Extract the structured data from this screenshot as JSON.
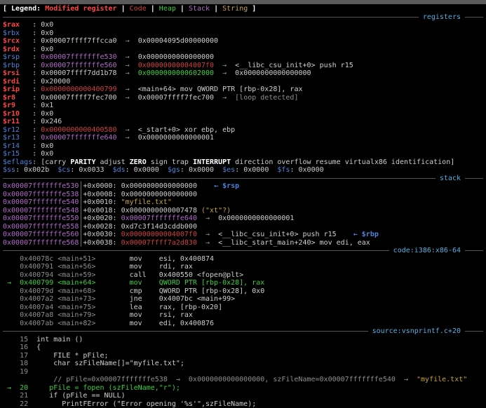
{
  "app": "gdb-gef-debugger-terminal",
  "palette": {
    "bg": "#000000",
    "chrome": "#5a5a5a",
    "fg": "#cfcfcf",
    "white_bold": "#ffffff",
    "reg_modified": "#ff4545",
    "code_red": "#cf4040",
    "blue": "#4f83d8",
    "purple": "#b06cc8",
    "yellow": "#c7a543",
    "green": "#3ecf3e",
    "gray": "#8f8f8f",
    "cyan": "#58aee0",
    "sep_line": "#565656"
  },
  "sections": [
    "registers",
    "stack",
    "code:i386:x86-64",
    "source:vsnprintf.c+20"
  ],
  "lines": [
    {
      "n": "legend-bar",
      "s": [
        [
          "[ Legend: ",
          "wb"
        ],
        [
          "Modified register",
          "rn"
        ],
        [
          " | ",
          "wb"
        ],
        [
          "Code",
          "rd"
        ],
        [
          " | ",
          "wb"
        ],
        [
          "Heap",
          "gn"
        ],
        [
          " | ",
          "wb"
        ],
        [
          "Stack",
          "pu"
        ],
        [
          " | ",
          "wb"
        ],
        [
          "String",
          "yl"
        ],
        [
          " ]",
          "wb"
        ]
      ]
    },
    {
      "sep": "registers",
      "n": "registers-separator"
    },
    {
      "n": "reg-rax",
      "s": [
        [
          "$rax",
          "rn"
        ],
        [
          "   : ",
          "w"
        ],
        [
          "0x0",
          "w"
        ]
      ]
    },
    {
      "n": "reg-rbx",
      "s": [
        [
          "$rbx",
          "bl"
        ],
        [
          "   : ",
          "w"
        ],
        [
          "0x0",
          "w"
        ]
      ]
    },
    {
      "n": "reg-rcx",
      "s": [
        [
          "$rcx",
          "rn"
        ],
        [
          "   : ",
          "w"
        ],
        [
          "0x00007ffff7ffcca0",
          "w"
        ],
        [
          "  →  ",
          "gy"
        ],
        [
          "0x00004095d00000000",
          "w"
        ]
      ]
    },
    {
      "n": "reg-rdx",
      "s": [
        [
          "$rdx",
          "rn"
        ],
        [
          "   : ",
          "w"
        ],
        [
          "0x0",
          "w"
        ]
      ]
    },
    {
      "n": "reg-rsp",
      "s": [
        [
          "$rsp",
          "bl"
        ],
        [
          "   : ",
          "w"
        ],
        [
          "0x00007fffffffe530",
          "pu"
        ],
        [
          "  →  ",
          "gy"
        ],
        [
          "0x0000000000000000",
          "w"
        ]
      ]
    },
    {
      "n": "reg-rbp",
      "s": [
        [
          "$rbp",
          "bl"
        ],
        [
          "   : ",
          "w"
        ],
        [
          "0x00007fffffffe560",
          "pu"
        ],
        [
          "  →  ",
          "gy"
        ],
        [
          "0x00000000004007f0",
          "rd"
        ],
        [
          "  →  ",
          "gy"
        ],
        [
          "<__libc_csu_init+0> push r15",
          "w"
        ]
      ]
    },
    {
      "n": "reg-rsi",
      "s": [
        [
          "$rsi",
          "rn"
        ],
        [
          "   : ",
          "w"
        ],
        [
          "0x00007ffff7dd1b78",
          "w"
        ],
        [
          "  →  ",
          "gy"
        ],
        [
          "0x0000000000602000",
          "gn"
        ],
        [
          "  →  ",
          "gy"
        ],
        [
          "0x0000000000000000",
          "w"
        ]
      ]
    },
    {
      "n": "reg-rdi",
      "s": [
        [
          "$rdi",
          "rn"
        ],
        [
          "   : ",
          "w"
        ],
        [
          "0x20000",
          "w"
        ]
      ]
    },
    {
      "n": "reg-rip",
      "s": [
        [
          "$rip",
          "rn"
        ],
        [
          "   : ",
          "w"
        ],
        [
          "0x0000000000400799",
          "rd"
        ],
        [
          "  →  ",
          "gy"
        ],
        [
          "<main+64> mov QWORD PTR [rbp-0x28], rax",
          "w"
        ]
      ]
    },
    {
      "n": "reg-r8",
      "s": [
        [
          "$r8",
          "rn"
        ],
        [
          "    : ",
          "w"
        ],
        [
          "0x00007ffff7fec700",
          "w"
        ],
        [
          "  →  ",
          "gy"
        ],
        [
          "0x00007ffff7fec700",
          "w"
        ],
        [
          "  →  ",
          "gy"
        ],
        [
          "[loop detected]",
          "gy"
        ]
      ]
    },
    {
      "n": "reg-r9",
      "s": [
        [
          "$r9",
          "rn"
        ],
        [
          "    : ",
          "w"
        ],
        [
          "0x1",
          "w"
        ]
      ]
    },
    {
      "n": "reg-r10",
      "s": [
        [
          "$r10",
          "rn"
        ],
        [
          "   : ",
          "w"
        ],
        [
          "0x0",
          "w"
        ]
      ]
    },
    {
      "n": "reg-r11",
      "s": [
        [
          "$r11",
          "rn"
        ],
        [
          "   : ",
          "w"
        ],
        [
          "0x246",
          "w"
        ]
      ]
    },
    {
      "n": "reg-r12",
      "s": [
        [
          "$r12",
          "bl"
        ],
        [
          "   : ",
          "w"
        ],
        [
          "0x0000000000400580",
          "rd"
        ],
        [
          "  →  ",
          "gy"
        ],
        [
          "<_start+0> xor ebp, ebp",
          "w"
        ]
      ]
    },
    {
      "n": "reg-r13",
      "s": [
        [
          "$r13",
          "bl"
        ],
        [
          "   : ",
          "w"
        ],
        [
          "0x00007fffffffe640",
          "pu"
        ],
        [
          "  →  ",
          "gy"
        ],
        [
          "0x0000000000000001",
          "w"
        ]
      ]
    },
    {
      "n": "reg-r14",
      "s": [
        [
          "$r14",
          "bl"
        ],
        [
          "   : ",
          "w"
        ],
        [
          "0x0",
          "w"
        ]
      ]
    },
    {
      "n": "reg-r15",
      "s": [
        [
          "$r15",
          "bl"
        ],
        [
          "   : ",
          "w"
        ],
        [
          "0x0",
          "w"
        ]
      ]
    },
    {
      "n": "reg-eflags",
      "s": [
        [
          "$eflags",
          "bl"
        ],
        [
          ": [",
          "w"
        ],
        [
          "carry ",
          "w"
        ],
        [
          "PARITY",
          "wb"
        ],
        [
          " adjust ",
          "w"
        ],
        [
          "ZERO",
          "wb"
        ],
        [
          " sign trap ",
          "w"
        ],
        [
          "INTERRUPT",
          "wb"
        ],
        [
          " direction overflow resume virtualx86 identification]",
          "w"
        ]
      ]
    },
    {
      "n": "reg-segment-selectors",
      "s": [
        [
          "$ss",
          "bl"
        ],
        [
          ": 0x002b  ",
          "w"
        ],
        [
          "$cs",
          "bl"
        ],
        [
          ": 0x0033  ",
          "w"
        ],
        [
          "$ds",
          "bl"
        ],
        [
          ": 0x0000  ",
          "w"
        ],
        [
          "$gs",
          "bl"
        ],
        [
          ": 0x0000  ",
          "w"
        ],
        [
          "$es",
          "bl"
        ],
        [
          ": 0x0000  ",
          "w"
        ],
        [
          "$fs",
          "bl"
        ],
        [
          ": 0x0000",
          "w"
        ]
      ]
    },
    {
      "sep": "stack",
      "n": "stack-separator"
    },
    {
      "n": "stack-row",
      "s": [
        [
          "0x00007fffffffe530",
          "pu"
        ],
        [
          "│",
          "gy"
        ],
        [
          "+0x0000: ",
          "w"
        ],
        [
          "0x0000000000000000",
          "w"
        ],
        [
          "    ",
          "w"
        ],
        [
          "← $rsp",
          "blb"
        ]
      ]
    },
    {
      "n": "stack-row",
      "s": [
        [
          "0x00007fffffffe538",
          "pu"
        ],
        [
          "│",
          "gy"
        ],
        [
          "+0x0008: ",
          "w"
        ],
        [
          "0x0000000000000000",
          "w"
        ]
      ]
    },
    {
      "n": "stack-row",
      "s": [
        [
          "0x00007fffffffe540",
          "pu"
        ],
        [
          "│",
          "gy"
        ],
        [
          "+0x0010: ",
          "w"
        ],
        [
          "\"myfile.txt\"",
          "yl"
        ]
      ]
    },
    {
      "n": "stack-row",
      "s": [
        [
          "0x00007fffffffe548",
          "pu"
        ],
        [
          "│",
          "gy"
        ],
        [
          "+0x0018: ",
          "w"
        ],
        [
          "0x0000000000007478",
          "w"
        ],
        [
          " (\"xt\"?)",
          "yl"
        ]
      ]
    },
    {
      "n": "stack-row",
      "s": [
        [
          "0x00007fffffffe550",
          "pu"
        ],
        [
          "│",
          "gy"
        ],
        [
          "+0x0020: ",
          "w"
        ],
        [
          "0x00007fffffffe640",
          "pu"
        ],
        [
          "  →  ",
          "gy"
        ],
        [
          "0x0000000000000001",
          "w"
        ]
      ]
    },
    {
      "n": "stack-row",
      "s": [
        [
          "0x00007fffffffe558",
          "pu"
        ],
        [
          "│",
          "gy"
        ],
        [
          "+0x0028: ",
          "w"
        ],
        [
          "0xd7c3f14d3cddb000",
          "w"
        ]
      ]
    },
    {
      "n": "stack-row",
      "s": [
        [
          "0x00007fffffffe560",
          "pu"
        ],
        [
          "│",
          "gy"
        ],
        [
          "+0x0030: ",
          "w"
        ],
        [
          "0x00000000004007f0",
          "rd"
        ],
        [
          "  →  ",
          "gy"
        ],
        [
          "<__libc_csu_init+0> push r15",
          "w"
        ],
        [
          "    ",
          "w"
        ],
        [
          "← $rbp",
          "blb"
        ]
      ]
    },
    {
      "n": "stack-row",
      "s": [
        [
          "0x00007fffffffe568",
          "pu"
        ],
        [
          "│",
          "gy"
        ],
        [
          "+0x0038: ",
          "w"
        ],
        [
          "0x00007ffff7a2d830",
          "rd"
        ],
        [
          "  →  ",
          "gy"
        ],
        [
          "<__libc_start_main+240> mov edi, eax",
          "w"
        ]
      ]
    },
    {
      "sep": "code:i386:x86-64",
      "n": "code-separator"
    },
    {
      "n": "code-row",
      "s": [
        [
          "    0x40078c <main+51>        ",
          "gy"
        ],
        [
          "mov    esi, 0x400874",
          "w"
        ]
      ]
    },
    {
      "n": "code-row",
      "s": [
        [
          "    0x400791 <main+56>        ",
          "gy"
        ],
        [
          "mov    rdi, rax",
          "w"
        ]
      ]
    },
    {
      "n": "code-row",
      "s": [
        [
          "    0x400794 <main+59>        ",
          "gy"
        ],
        [
          "call   0x400550 <fopen@plt>",
          "w"
        ]
      ]
    },
    {
      "n": "code-row-current",
      "s": [
        [
          " →  0x400799 <main+64>        mov    QWORD PTR [rbp-0x28], rax",
          "gn"
        ]
      ]
    },
    {
      "n": "code-row",
      "s": [
        [
          "    0x40079d <main+68>        ",
          "gy"
        ],
        [
          "cmp    QWORD PTR [rbp-0x28], 0x0",
          "w"
        ]
      ]
    },
    {
      "n": "code-row",
      "s": [
        [
          "    0x4007a2 <main+73>        ",
          "gy"
        ],
        [
          "jne    0x4007bc <main+99>",
          "w"
        ]
      ]
    },
    {
      "n": "code-row",
      "s": [
        [
          "    0x4007a4 <main+75>        ",
          "gy"
        ],
        [
          "lea    rax, [rbp-0x20]",
          "w"
        ]
      ]
    },
    {
      "n": "code-row",
      "s": [
        [
          "    0x4007a8 <main+79>        ",
          "gy"
        ],
        [
          "mov    rsi, rax",
          "w"
        ]
      ]
    },
    {
      "n": "code-row",
      "s": [
        [
          "    0x4007ab <main+82>        ",
          "gy"
        ],
        [
          "mov    edi, 0x400876",
          "w"
        ]
      ]
    },
    {
      "sep": "source:vsnprintf.c+20",
      "n": "source-separator"
    },
    {
      "n": "source-row",
      "s": [
        [
          "    15  ",
          "gy"
        ],
        [
          "int main ()",
          "w"
        ]
      ]
    },
    {
      "n": "source-row",
      "s": [
        [
          "    16  ",
          "gy"
        ],
        [
          "{",
          "w"
        ]
      ]
    },
    {
      "n": "source-row",
      "s": [
        [
          "    17  ",
          "gy"
        ],
        [
          "    FILE * pFile;",
          "w"
        ]
      ]
    },
    {
      "n": "source-row",
      "s": [
        [
          "    18  ",
          "gy"
        ],
        [
          "    char szFileName[]=\"myfile.txt\";",
          "w"
        ]
      ]
    },
    {
      "n": "source-row",
      "s": [
        [
          "    19  ",
          "gy"
        ]
      ]
    },
    {
      "n": "source-annotation",
      "s": [
        [
          "            // pFile=0x00007fffffffe538  →  0x0000000000000000, szFileName=0x00007fffffffe540  →  ",
          "gy"
        ],
        [
          "\"myfile.txt\"",
          "yl"
        ]
      ]
    },
    {
      "n": "source-row-current",
      "s": [
        [
          " →  20     pFile = fopen (szFileName,\"r\");",
          "gn"
        ]
      ]
    },
    {
      "n": "source-row",
      "s": [
        [
          "    21     ",
          "gy"
        ],
        [
          "if (pFile == NULL)",
          "w"
        ]
      ]
    },
    {
      "n": "source-row",
      "s": [
        [
          "    22        ",
          "gy"
        ],
        [
          "PrintFError (\"Error opening '%s'\",szFileName);",
          "w"
        ]
      ]
    }
  ]
}
